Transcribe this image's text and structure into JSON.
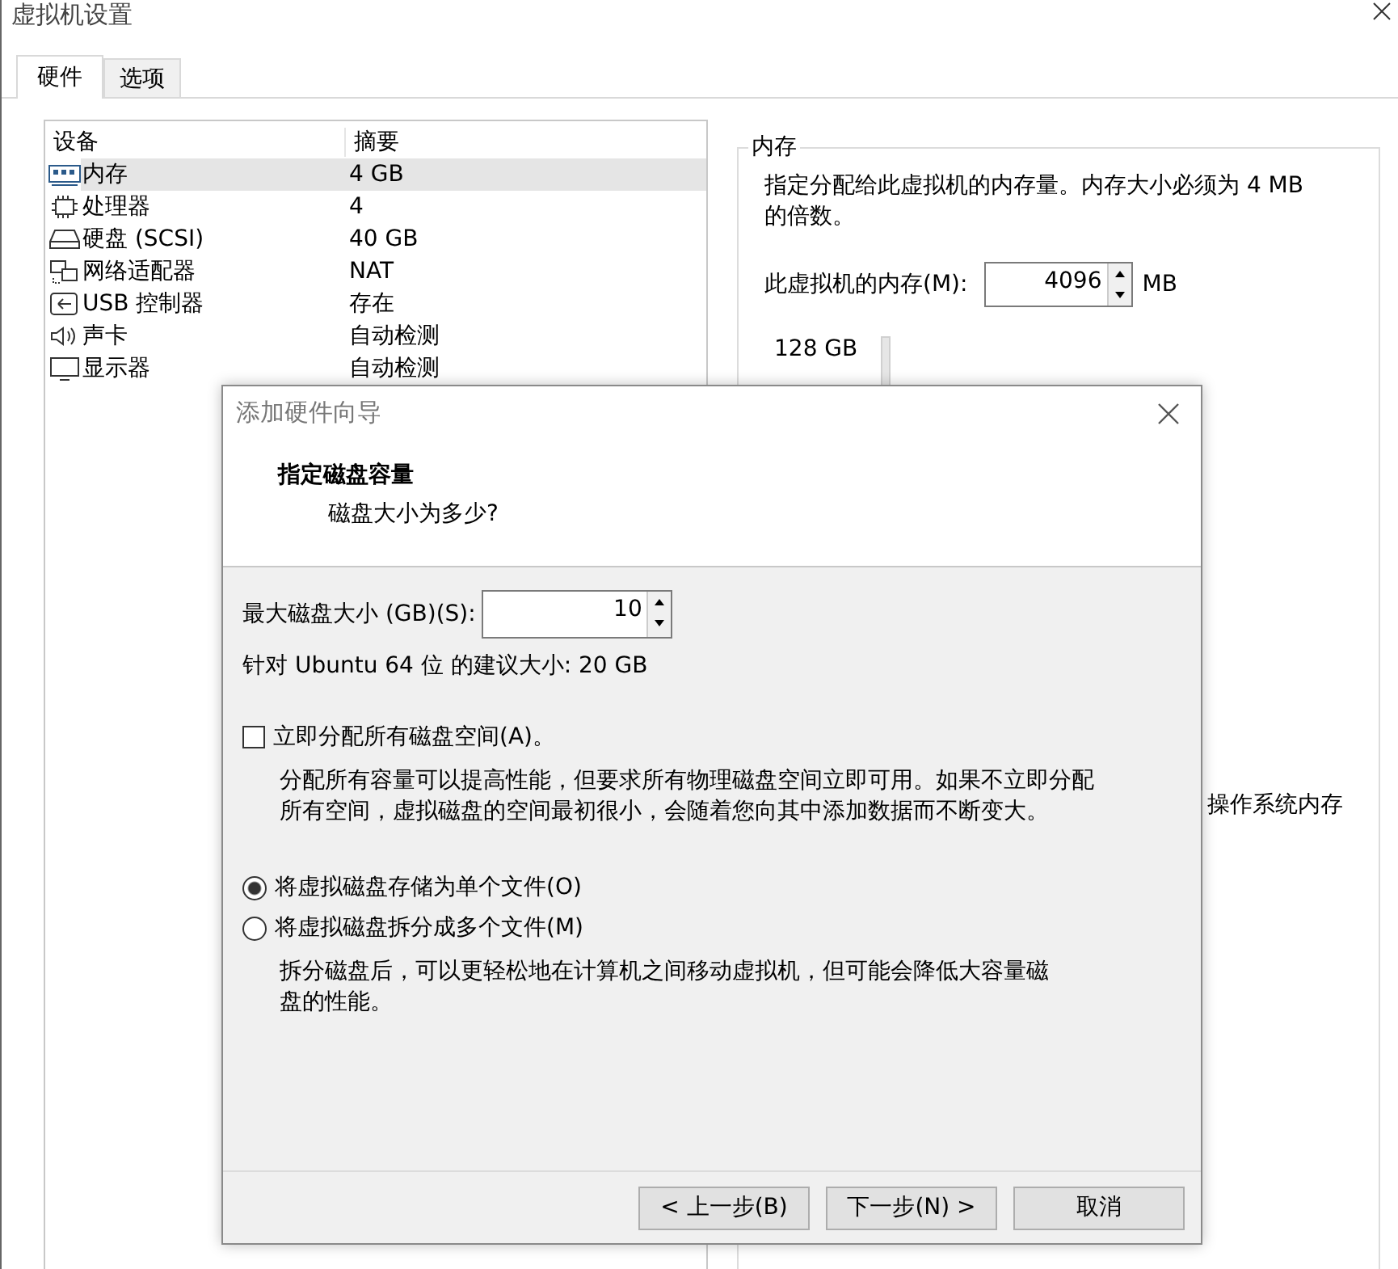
{
  "window": {
    "title": "虚拟机设置"
  },
  "tabs": [
    {
      "label": "硬件",
      "selected": true
    },
    {
      "label": "选项",
      "selected": false
    }
  ],
  "device_table": {
    "columns": [
      "设备",
      "摘要"
    ],
    "rows": [
      {
        "kind": "memory",
        "device": "内存",
        "summary": "4 GB",
        "selected": true
      },
      {
        "kind": "cpu",
        "device": "处理器",
        "summary": "4",
        "selected": false
      },
      {
        "kind": "disk",
        "device": "硬盘 (SCSI)",
        "summary": "40 GB",
        "selected": false
      },
      {
        "kind": "network",
        "device": "网络适配器",
        "summary": "NAT",
        "selected": false
      },
      {
        "kind": "usb",
        "device": "USB 控制器",
        "summary": "存在",
        "selected": false
      },
      {
        "kind": "sound",
        "device": "声卡",
        "summary": "自动检测",
        "selected": false
      },
      {
        "kind": "display",
        "device": "显示器",
        "summary": "自动检测",
        "selected": false
      }
    ]
  },
  "memory_panel": {
    "title": "内存",
    "description": "指定分配给此虚拟机的内存量。内存大小必须为 4 MB 的倍数。",
    "memory_label": "此虚拟机的内存(M):",
    "memory_value": "4096",
    "unit": "MB",
    "scale_label": "128 GB",
    "note_fragment": "操作系统内存"
  },
  "dialog": {
    "title": "添加硬件向导",
    "heading": "指定磁盘容量",
    "subheading": "磁盘大小为多少?",
    "size_label": "最大磁盘大小 (GB)(S):",
    "size_value": "10",
    "recommendation": "针对 Ubuntu 64 位 的建议大小: 20 GB",
    "allocate": {
      "label": "立即分配所有磁盘空间(A)。",
      "checked": false,
      "description": "分配所有容量可以提高性能，但要求所有物理磁盘空间立即可用。如果不立即分配所有空间，虚拟磁盘的空间最初很小，会随着您向其中添加数据而不断变大。"
    },
    "storage_options": [
      {
        "label": "将虚拟磁盘存储为单个文件(O)",
        "selected": true
      },
      {
        "label": "将虚拟磁盘拆分成多个文件(M)",
        "selected": false,
        "description": "拆分磁盘后，可以更轻松地在计算机之间移动虚拟机，但可能会降低大容量磁盘的性能。"
      }
    ],
    "buttons": [
      "< 上一步(B)",
      "下一步(N) >",
      "取消"
    ]
  }
}
